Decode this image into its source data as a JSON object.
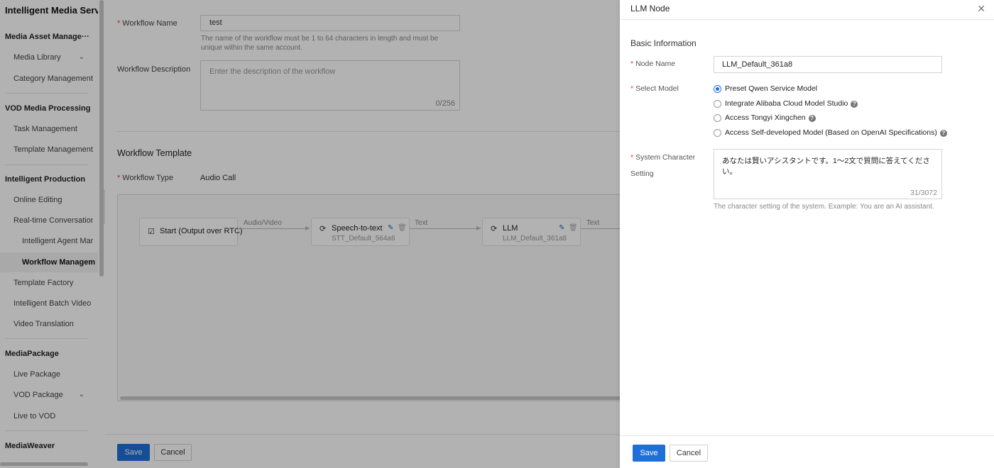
{
  "sidebar": {
    "brand": "Intelligent Media Servic",
    "groups": {
      "media_asset": "Media Asset Manage···",
      "vod_processing": "VOD Media Processing",
      "intelligent_production": "Intelligent Production",
      "media_package": "MediaPackage",
      "media_weaver": "MediaWeaver"
    },
    "items": {
      "media_library": "Media Library",
      "category_management": "Category Management··",
      "task_management": "Task Management",
      "template_management": "Template Management··",
      "online_editing": "Online Editing",
      "realtime_conversations": "Real-time Conversations",
      "intelligent_agent": "Intelligent Agent Man:",
      "workflow_management": "Workflow Managem",
      "template_factory": "Template Factory",
      "batch_video": "Intelligent Batch Video P",
      "video_translation": "Video Translation",
      "live_package": "Live Package",
      "vod_package": "VOD Package",
      "live_to_vod": "Live to VOD"
    }
  },
  "form": {
    "workflow_name_label": "Workflow Name",
    "workflow_name_value": "test",
    "workflow_name_help": "The name of the workflow must be 1 to 64 characters in length and must be unique within the same account.",
    "workflow_desc_label": "Workflow Description",
    "workflow_desc_placeholder": "Enter the description of the workflow",
    "workflow_desc_counter": "0/256",
    "template_title": "Workflow Template",
    "workflow_type_label": "Workflow Type",
    "workflow_type_value": "Audio Call"
  },
  "flow": {
    "start_node": "Start (Output over RTC)",
    "edge1": "Audio/Video",
    "stt_title": "Speech-to-text",
    "stt_sub": "STT_Default_564a6",
    "edge2": "Text",
    "llm_title": "LLM",
    "llm_sub": "LLM_Default_361a8",
    "edge3": "Text"
  },
  "footer": {
    "save": "Save",
    "cancel": "Cancel"
  },
  "drawer": {
    "title": "LLM Node",
    "section": "Basic Information",
    "node_name_label": "Node Name",
    "node_name_value": "LLM_Default_361a8",
    "select_model_label": "Select Model",
    "models": [
      "Preset Qwen Service Model",
      "Integrate Alibaba Cloud Model Studio",
      "Access Tongyi Xingchen",
      "Access Self-developed Model (Based on OpenAI Specifications)"
    ],
    "selected_model_index": 0,
    "system_label_1": "System Character",
    "system_label_2": "Setting",
    "system_value": "あなたは賢いアシスタントです。1～2文で質問に答えてください。",
    "system_counter": "31/3072",
    "system_help": "The character setting of the system. Example: You are an AI assistant.",
    "save": "Save",
    "cancel": "Cancel"
  }
}
